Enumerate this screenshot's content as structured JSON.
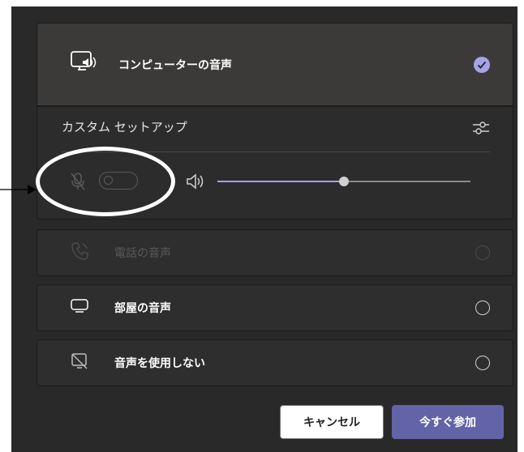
{
  "audio_options": {
    "computer": {
      "label": "コンピューターの音声",
      "selected": true,
      "icon": "computer-audio-icon"
    },
    "custom_setup": {
      "title": "カスタム セットアップ",
      "mic_icon": "mic-off-icon",
      "speaker_icon": "speaker-icon",
      "mic_enabled": false,
      "volume_fraction": 0.5
    },
    "phone": {
      "label": "電話の音声",
      "disabled": true,
      "icon": "phone-audio-icon"
    },
    "room": {
      "label": "部屋の音声",
      "icon": "room-audio-icon"
    },
    "none": {
      "label": "音声を使用しない",
      "icon": "no-audio-icon"
    }
  },
  "buttons": {
    "cancel": "キャンセル",
    "join_now": "今すぐ参加"
  },
  "colors": {
    "accent": "#6264a7",
    "check": "#a7a3e8",
    "background": "#292929",
    "annotation": "#ffffff"
  }
}
